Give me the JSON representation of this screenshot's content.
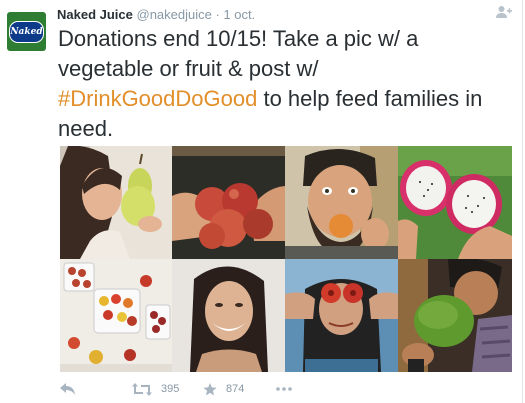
{
  "tweet": {
    "author_name": "Naked Juice",
    "author_handle": "@nakedjuice",
    "separator": "·",
    "date": "1 oct.",
    "avatar_logo_text": "Naked",
    "text_before": "Donations end 10/15! Take a pic w/ a vegetable or fruit & post w/ ",
    "hashtag": "#DrinkGoodDoGood",
    "text_after": " to help feed families in need."
  },
  "media": {
    "tiles": [
      {
        "icon": "woman-with-pear-photo"
      },
      {
        "icon": "hands-holding-peaches-photo"
      },
      {
        "icon": "man-with-apricot-photo"
      },
      {
        "icon": "dragon-fruit-halves-photo"
      },
      {
        "icon": "bowls-of-cherry-tomatoes-photo"
      },
      {
        "icon": "smiling-woman-portrait-photo"
      },
      {
        "icon": "woman-with-fruit-eyes-photo"
      },
      {
        "icon": "man-holding-melon-photo"
      }
    ]
  },
  "actions": {
    "reply_icon": "reply-icon",
    "retweet_icon": "retweet-icon",
    "retweet_count": "395",
    "favorite_icon": "star-icon",
    "favorite_count": "874",
    "more_icon": "more-icon"
  },
  "colors": {
    "hashtag": "#e28f2a",
    "text": "#292f33",
    "muted": "#8899a6",
    "avatar_bg": "#2e7d32"
  }
}
